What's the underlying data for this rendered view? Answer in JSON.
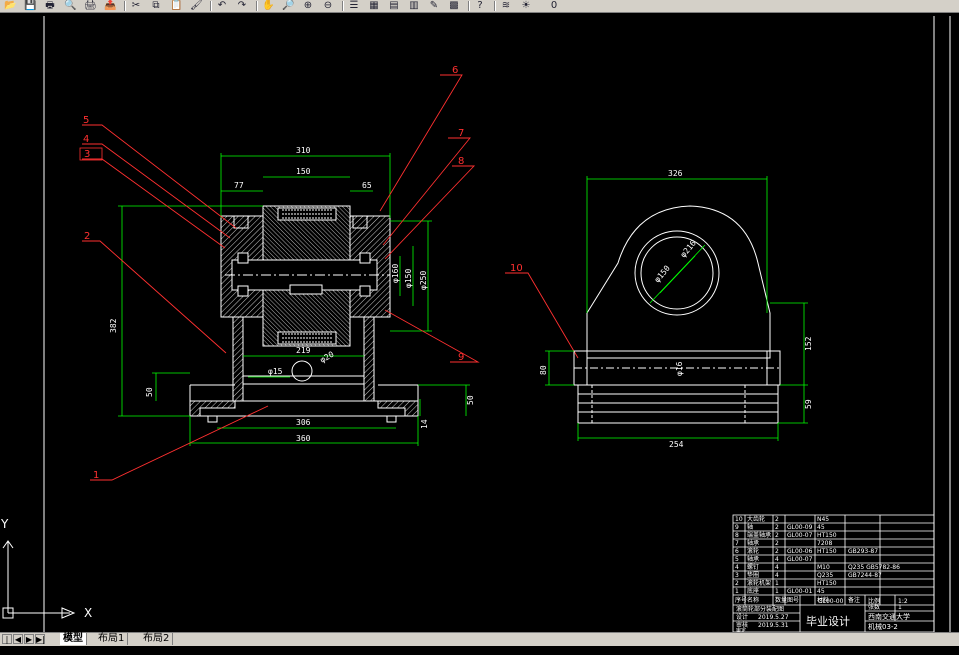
{
  "toolbar": {
    "icons": [
      "open-icon",
      "save-icon",
      "print-icon",
      "preview-icon",
      "plot-icon",
      "publish-icon",
      "cut-icon",
      "copy-icon",
      "paste-icon",
      "match-properties-icon",
      "undo-icon",
      "redo-icon",
      "pan-icon",
      "zoom-realtime-icon",
      "zoom-window-icon",
      "zoom-previous-icon",
      "properties-icon",
      "design-center-icon",
      "tool-palette-icon",
      "sheet-set-icon",
      "markup-icon",
      "calculator-icon",
      "help-icon",
      "layer-icon",
      "layer-state-icon"
    ],
    "layer_value": "0"
  },
  "balloons": {
    "front": [
      {
        "num": "6"
      },
      {
        "num": "7"
      },
      {
        "num": "8"
      },
      {
        "num": "5"
      },
      {
        "num": "4"
      },
      {
        "num": "3"
      },
      {
        "num": "2"
      },
      {
        "num": "9"
      },
      {
        "num": "1"
      }
    ],
    "side": [
      {
        "num": "10"
      }
    ]
  },
  "dimensions": {
    "front": {
      "overall_top": "310",
      "hub_width": "150",
      "left_offset": "77",
      "right_offset": "65",
      "height_total": "382",
      "height_base": "50",
      "shaft_length": "219",
      "bore_small": "φ15",
      "bore_hole": "φ20",
      "base_inner": "306",
      "base_outer": "360",
      "base_right_h": "14",
      "base_far_h": "50",
      "dia_a": "φ160",
      "dia_b": "φ150",
      "dia_c": "φ250"
    },
    "side": {
      "top_width": "326",
      "dia_outer": "φ216",
      "dia_inner": "φ150",
      "height_right": "152",
      "base_h": "59",
      "left_h": "80",
      "small_dim": "φ16",
      "bottom_width": "254"
    }
  },
  "title_block": {
    "parts": [
      {
        "no": "10",
        "name": "大齿轮",
        "qty": "2",
        "code": "",
        "material": "N45",
        "note": ""
      },
      {
        "no": "9",
        "name": "轴",
        "qty": "2",
        "code": "GL00-09",
        "material": "45",
        "note": ""
      },
      {
        "no": "8",
        "name": "端盖轴承",
        "qty": "2",
        "code": "GL00-07",
        "material": "HT150",
        "note": ""
      },
      {
        "no": "7",
        "name": "轴承",
        "qty": "2",
        "code": "",
        "material": "7208",
        "note": ""
      },
      {
        "no": "6",
        "name": "滚轮",
        "qty": "2",
        "code": "GL00-06",
        "material": "HT150",
        "note": "GB293-87"
      },
      {
        "no": "5",
        "name": "轴承",
        "qty": "4",
        "code": "GL00-07",
        "material": "",
        "note": ""
      },
      {
        "no": "4",
        "name": "螺钉",
        "qty": "4",
        "code": "",
        "material": "M10",
        "note": "Q235 GB5782-86"
      },
      {
        "no": "3",
        "name": "垫圈",
        "qty": "4",
        "code": "",
        "material": "Q235",
        "note": "GB7244-87"
      },
      {
        "no": "2",
        "name": "滚轮机架",
        "qty": "1",
        "code": "",
        "material": "HT150",
        "note": ""
      },
      {
        "no": "1",
        "name": "底座",
        "qty": "1",
        "code": "GL00-01",
        "material": "45",
        "note": ""
      }
    ],
    "header": [
      "序号",
      "名称",
      "数量",
      "图号",
      "材料",
      "备注"
    ],
    "drawing_title": "滚筒轮部分装配图",
    "drawing_code": "GL00-00",
    "scale_label": "比例",
    "scale": "1:2",
    "sheet_label": "张数",
    "sheet": "1",
    "design_label": "设计",
    "check_label": "审核",
    "approve_label": "审定",
    "date1": "2019.5.27",
    "date2": "2019.5.31",
    "project": "毕业设计",
    "university": "西南交通大学",
    "class": "机械03-2"
  },
  "ucs": {
    "x_label": "X",
    "y_label": "Y"
  },
  "tabs": {
    "model": "模型",
    "layout1": "布局1",
    "layout2": "布局2"
  },
  "colors": {
    "line_white": "#ffffff",
    "dim_green": "#00ff00",
    "leader_red": "#ff3030",
    "hatch": "#ffffff",
    "title_frame": "#ffffff"
  }
}
